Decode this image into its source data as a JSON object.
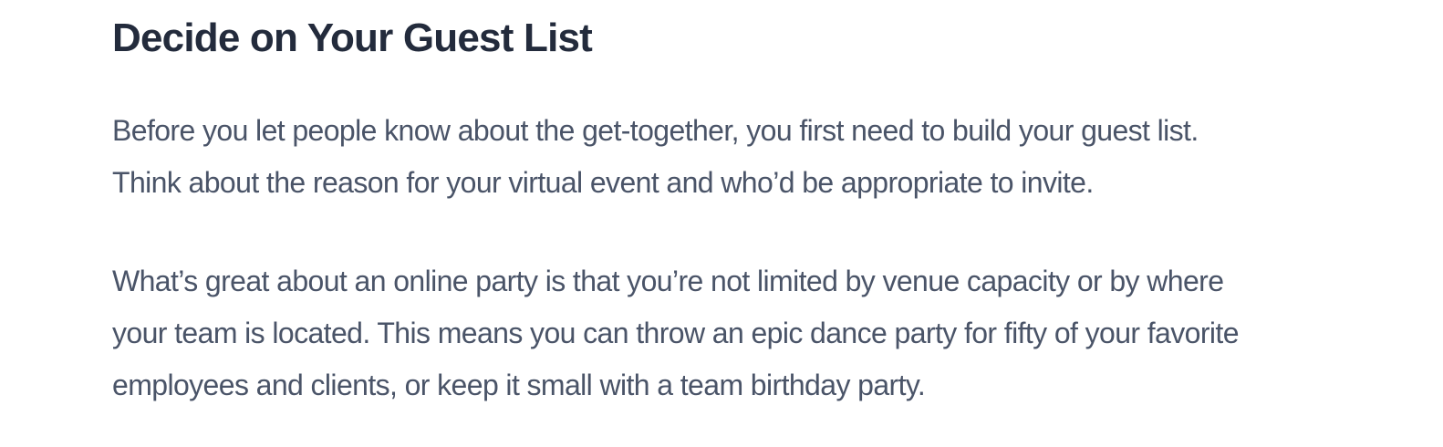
{
  "article": {
    "heading": "Decide on Your Guest List",
    "paragraph_1": [
      "Before you let people know about the get-together, you first need to build your guest list.",
      "Think about the reason for your virtual event and who’d be appropriate to invite."
    ],
    "paragraph_2": [
      "What’s great about an online party is that you’re not limited by venue capacity or by where",
      "your team is located. This means you can throw an epic dance party for fifty of your favorite",
      "employees and clients, or keep it small with a team birthday party."
    ]
  }
}
